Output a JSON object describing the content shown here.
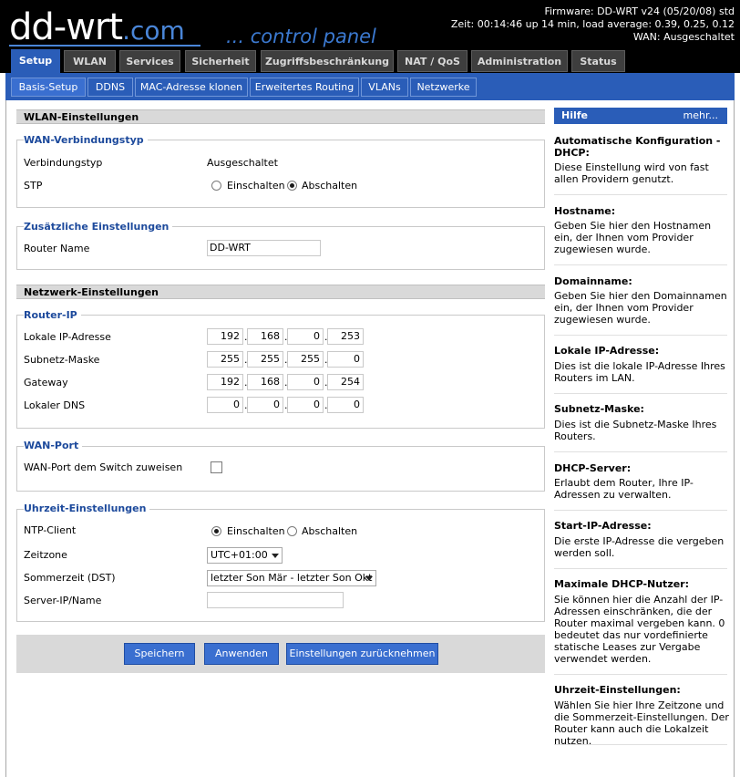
{
  "header": {
    "logo_main": "dd-wrt",
    "logo_suffix": ".com",
    "control_panel": "... control panel",
    "firmware": "Firmware: DD-WRT v24 (05/20/08) std",
    "time": "Zeit: 00:14:46 up 14 min, load average: 0.39, 0.25, 0.12",
    "wan": "WAN: Ausgeschaltet"
  },
  "main_tabs": [
    "Setup",
    "WLAN",
    "Services",
    "Sicherheit",
    "Zugriffsbeschränkung",
    "NAT / QoS",
    "Administration",
    "Status"
  ],
  "sub_tabs": [
    "Basis-Setup",
    "DDNS",
    "MAC-Adresse klonen",
    "Erweitertes Routing",
    "VLANs",
    "Netzwerke"
  ],
  "wlan": {
    "section": "WLAN-Einstellungen",
    "group": "WAN-Verbindungstyp",
    "conn_label": "Verbindungstyp",
    "conn_value": "Ausgeschaltet",
    "stp_label": "STP",
    "stp_on": "Einschalten",
    "stp_off": "Abschalten"
  },
  "extra": {
    "group": "Zusätzliche Einstellungen",
    "router_name_label": "Router Name",
    "router_name_value": "DD-WRT"
  },
  "network": {
    "section": "Netzwerk-Einstellungen",
    "group": "Router-IP",
    "local_ip_label": "Lokale IP-Adresse",
    "local_ip": [
      "192",
      "168",
      "0",
      "253"
    ],
    "subnet_label": "Subnetz-Maske",
    "subnet": [
      "255",
      "255",
      "255",
      "0"
    ],
    "gateway_label": "Gateway",
    "gateway": [
      "192",
      "168",
      "0",
      "254"
    ],
    "dns_label": "Lokaler DNS",
    "dns": [
      "0",
      "0",
      "0",
      "0"
    ]
  },
  "wanport": {
    "group": "WAN-Port",
    "label": "WAN-Port dem Switch zuweisen"
  },
  "time": {
    "group": "Uhrzeit-Einstellungen",
    "ntp_label": "NTP-Client",
    "ntp_on": "Einschalten",
    "ntp_off": "Abschalten",
    "tz_label": "Zeitzone",
    "tz_value": "UTC+01:00",
    "dst_label": "Sommerzeit (DST)",
    "dst_value": "letzter Son Mär - letzter Son Okt",
    "server_label": "Server-IP/Name",
    "server_value": ""
  },
  "buttons": {
    "save": "Speichern",
    "apply": "Anwenden",
    "reset": "Einstellungen zurücknehmen"
  },
  "help": {
    "title": "Hilfe",
    "more": "mehr...",
    "items": [
      {
        "title": "Automatische Konfiguration - DHCP:",
        "text": "Diese Einstellung wird von fast allen Providern genutzt."
      },
      {
        "title": "Hostname:",
        "text": "Geben Sie hier den Hostnamen ein, der Ihnen vom Provider zugewiesen wurde."
      },
      {
        "title": "Domainname:",
        "text": "Geben Sie hier den Domainnamen ein, der Ihnen vom Provider zugewiesen wurde."
      },
      {
        "title": "Lokale IP-Adresse:",
        "text": "Dies ist die lokale IP-Adresse Ihres Routers im LAN."
      },
      {
        "title": "Subnetz-Maske:",
        "text": "Dies ist die Subnetz-Maske Ihres Routers."
      },
      {
        "title": "DHCP-Server:",
        "text": "Erlaubt dem Router, Ihre IP-Adressen zu verwalten."
      },
      {
        "title": "Start-IP-Adresse:",
        "text": "Die erste IP-Adresse die vergeben werden soll."
      },
      {
        "title": "Maximale DHCP-Nutzer:",
        "text": "Sie können hier die Anzahl der IP-Adressen einschränken, die der Router maximal vergeben kann. 0 bedeutet das nur vordefinierte statische Leases zur Vergabe verwendet werden."
      },
      {
        "title": "Uhrzeit-Einstellungen:",
        "text": "Wählen Sie hier Ihre Zeitzone und die Sommerzeit-Einstellungen. Der Router kann auch die Lokalzeit nutzen."
      }
    ]
  }
}
